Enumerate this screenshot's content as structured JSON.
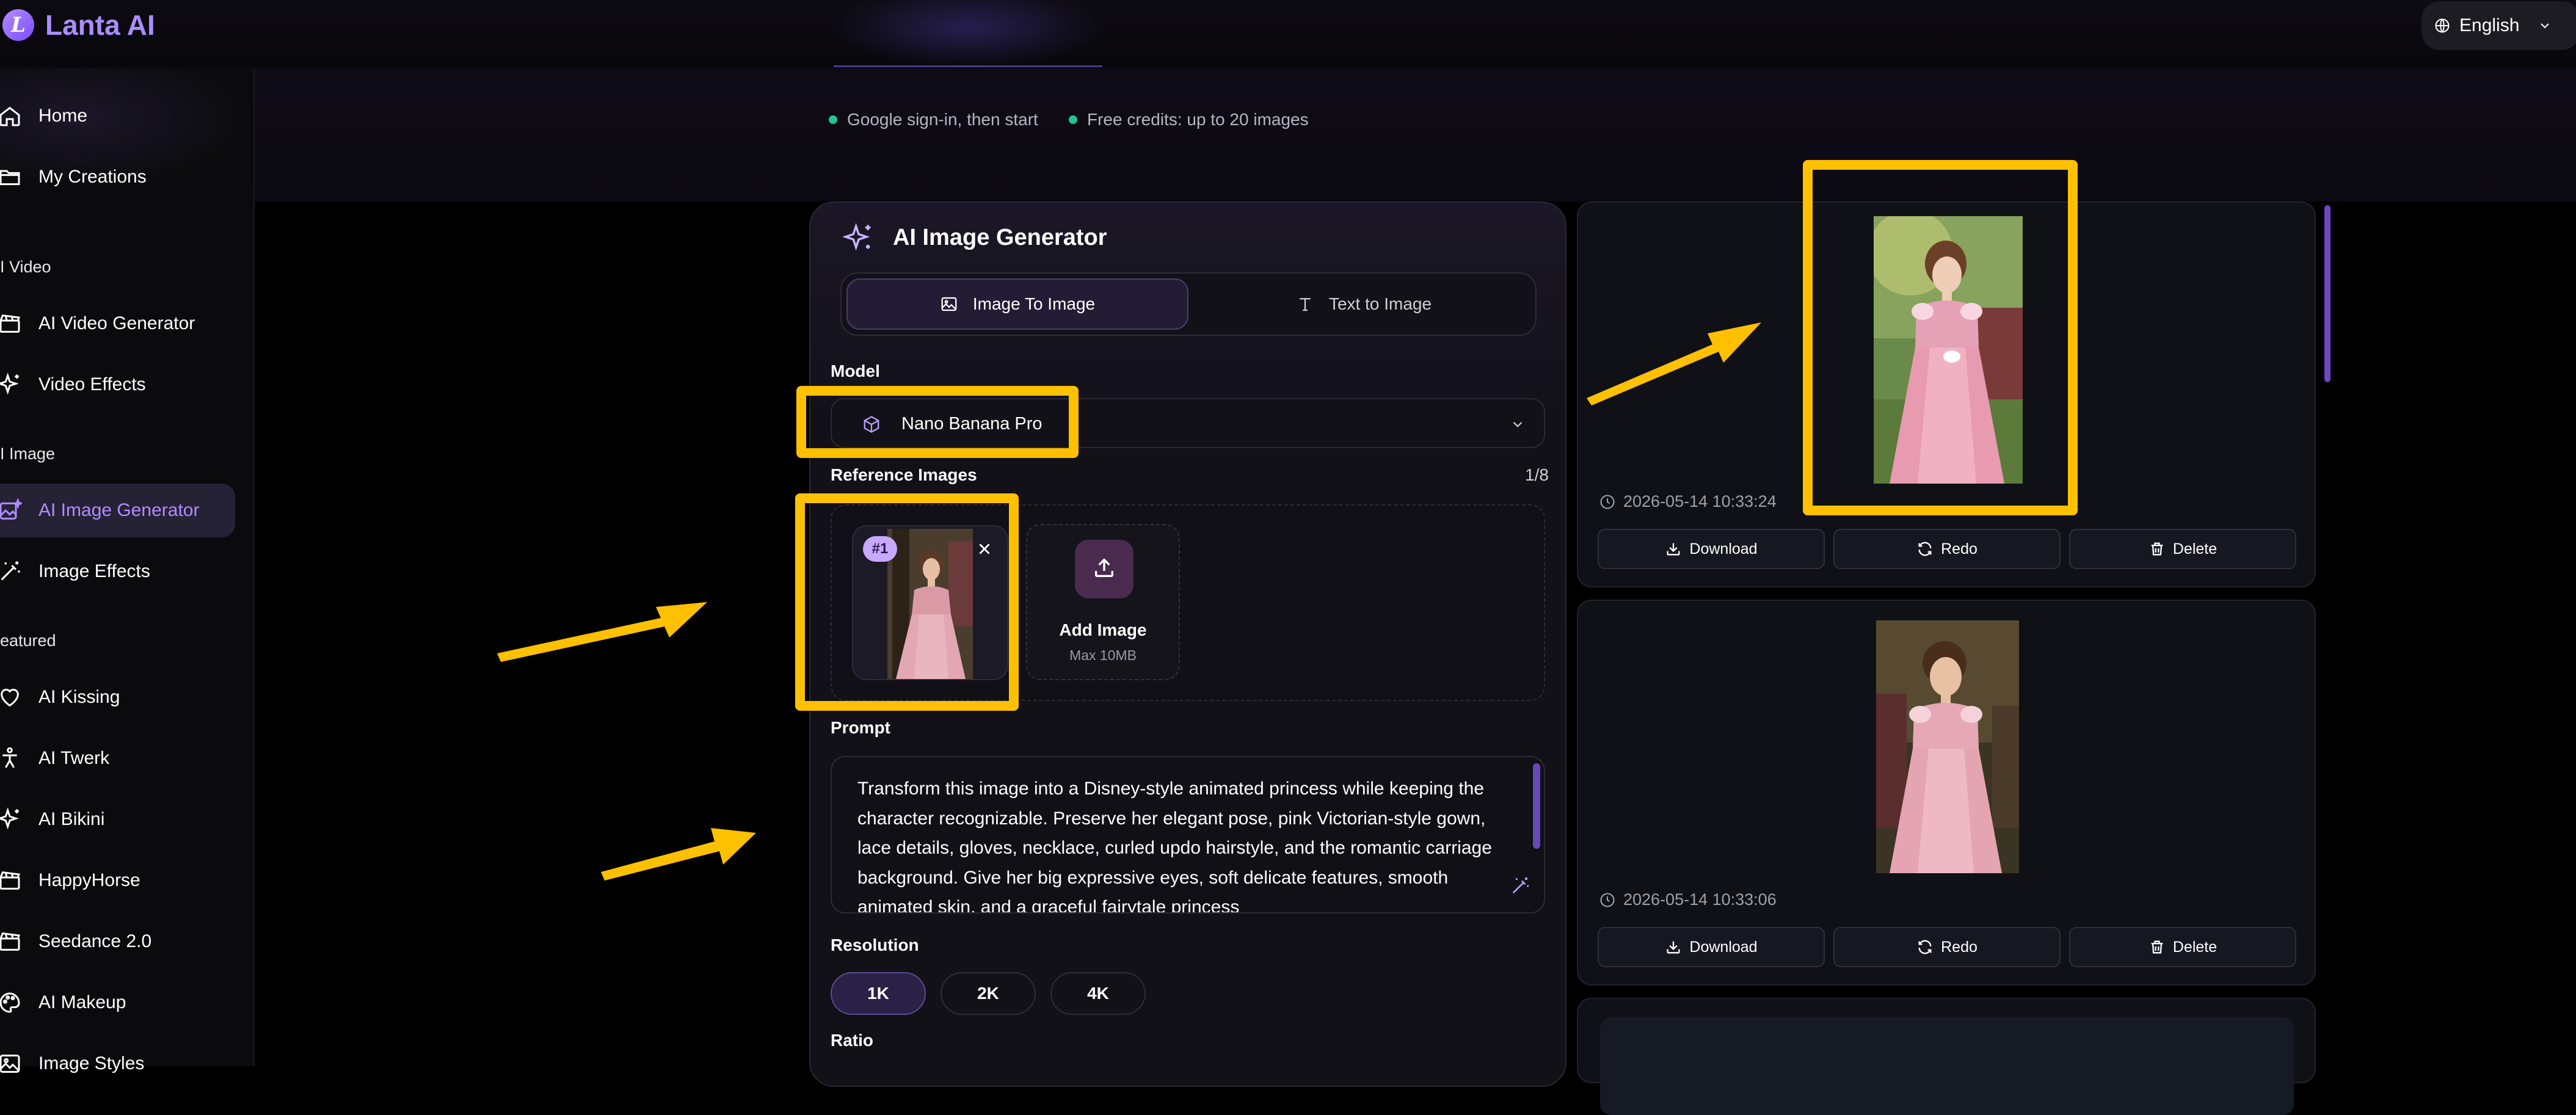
{
  "header": {
    "brand_initial": "L",
    "brand_name": "Lanta AI",
    "language": "English"
  },
  "sidebar": {
    "items": [
      {
        "label": "Home",
        "icon": "home-icon"
      },
      {
        "label": "My Creations",
        "icon": "folder-icon"
      },
      {
        "label": "AI Video Generator",
        "icon": "clapperboard-icon"
      },
      {
        "label": "Video Effects",
        "icon": "sparkles-icon"
      },
      {
        "label": "AI Image Generator",
        "icon": "image-sparkle-icon",
        "active": true
      },
      {
        "label": "Image Effects",
        "icon": "magic-wand-icon"
      },
      {
        "label": "AI Kissing",
        "icon": "heart-icon"
      },
      {
        "label": "AI Twerk",
        "icon": "person-icon"
      },
      {
        "label": "AI Bikini",
        "icon": "sparkles-icon"
      },
      {
        "label": "HappyHorse",
        "icon": "clapperboard-icon"
      },
      {
        "label": "Seedance 2.0",
        "icon": "clapperboard-icon"
      },
      {
        "label": "AI Makeup",
        "icon": "palette-icon"
      },
      {
        "label": "Image Styles",
        "icon": "image-icon"
      }
    ],
    "sections": [
      "I Video",
      "I Image",
      "eatured"
    ]
  },
  "info": {
    "note1": "Google sign-in, then start",
    "note2": "Free credits: up to 20 images"
  },
  "generator": {
    "title": "AI Image Generator",
    "tabs": [
      {
        "label": "Image To Image",
        "active": true
      },
      {
        "label": "Text to Image",
        "active": false
      }
    ],
    "model_label": "Model",
    "model_value": "Nano Banana Pro",
    "reference_label": "Reference Images",
    "reference_count": "1/8",
    "thumb_badge": "#1",
    "add_image": "Add Image",
    "add_image_hint": "Max 10MB",
    "prompt_label": "Prompt",
    "prompt_text": "Transform this image into a Disney-style animated princess while keeping the character recognizable. Preserve her elegant pose, pink Victorian-style gown, lace details, gloves, necklace, curled updo hairstyle, and the romantic carriage background. Give her big expressive eyes, soft delicate features, smooth animated skin, and a graceful fairytale princess",
    "resolution_label": "Resolution",
    "resolutions": [
      {
        "label": "1K",
        "active": true
      },
      {
        "label": "2K",
        "active": false
      },
      {
        "label": "4K",
        "active": false
      }
    ],
    "ratio_label": "Ratio"
  },
  "results": [
    {
      "timestamp": "2026-05-14 10:33:24",
      "download": "Download",
      "redo": "Redo",
      "delete": "Delete"
    },
    {
      "timestamp": "2026-05-14 10:33:06",
      "download": "Download",
      "redo": "Redo",
      "delete": "Delete"
    }
  ],
  "colors": {
    "accent": "#a98dff",
    "highlight": "#ffc000",
    "status_dot": "#22c58b"
  }
}
